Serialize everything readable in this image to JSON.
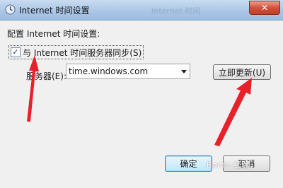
{
  "window": {
    "title": "Internet 时间设置",
    "blurred_background_text": "Internet 时间",
    "close_label": "✕"
  },
  "dialog": {
    "heading": "配置 Internet 时间设置:",
    "sync_checkbox": {
      "label": "与 Internet 时间服务器同步(S)",
      "checked": true
    },
    "server_label": "服务器(E):",
    "server_value": "time.windows.com",
    "update_button": "立即更新(U)",
    "ok_button": "确定",
    "cancel_button": "取消"
  },
  "watermark": "Baidu 经验",
  "colors": {
    "annotation_arrow": "#e8202a",
    "titlebar": "#a9c5e6",
    "close_button": "#d0523a"
  }
}
